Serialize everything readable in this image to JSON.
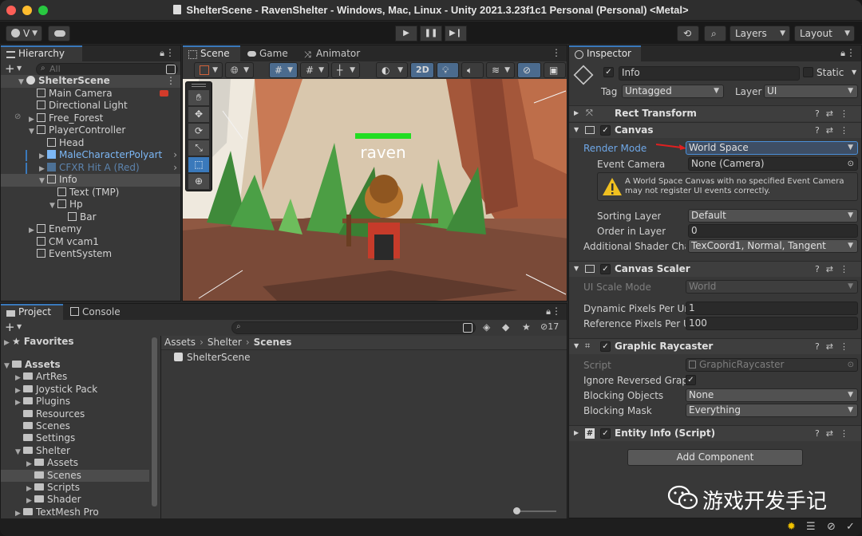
{
  "window": {
    "title": "ShelterScene - RavenShelter - Windows, Mac, Linux - Unity 2021.3.23f1c1 Personal (Personal) <Metal>"
  },
  "toolbar": {
    "account_label": "V",
    "layers_label": "Layers",
    "layout_label": "Layout",
    "play_icon": "play-icon",
    "pause_icon": "pause-icon",
    "step_icon": "step-icon"
  },
  "hierarchy": {
    "tab_label": "Hierarchy",
    "search_placeholder": "All",
    "items": [
      {
        "label": "ShelterScene",
        "depth": 0,
        "expanded": true,
        "kind": "scene"
      },
      {
        "label": "Main Camera",
        "depth": 1,
        "kind": "object"
      },
      {
        "label": "Directional Light",
        "depth": 1,
        "kind": "object"
      },
      {
        "label": "Free_Forest",
        "depth": 1,
        "expanded": false,
        "kind": "object"
      },
      {
        "label": "PlayerController",
        "depth": 1,
        "expanded": true,
        "kind": "object"
      },
      {
        "label": "Head",
        "depth": 2,
        "kind": "object"
      },
      {
        "label": "MaleCharacterPolyart",
        "depth": 2,
        "expanded": false,
        "kind": "prefab"
      },
      {
        "label": "CFXR Hit A (Red)",
        "depth": 2,
        "expanded": false,
        "kind": "prefab-dim"
      },
      {
        "label": "Info",
        "depth": 2,
        "expanded": true,
        "kind": "object",
        "selected": true
      },
      {
        "label": "Text (TMP)",
        "depth": 3,
        "kind": "object"
      },
      {
        "label": "Hp",
        "depth": 3,
        "expanded": true,
        "kind": "object"
      },
      {
        "label": "Bar",
        "depth": 4,
        "kind": "object"
      },
      {
        "label": "Enemy",
        "depth": 1,
        "expanded": false,
        "kind": "object"
      },
      {
        "label": "CM vcam1",
        "depth": 1,
        "kind": "object"
      },
      {
        "label": "EventSystem",
        "depth": 1,
        "kind": "object"
      }
    ]
  },
  "scene_view": {
    "tabs": [
      "Scene",
      "Game",
      "Animator"
    ],
    "mode_2d_label": "2D",
    "character_name": "raven",
    "health_fraction": 1.0,
    "health_color": "#22dd22"
  },
  "project": {
    "tabs": [
      "Project",
      "Console"
    ],
    "hidden_count": "17",
    "favorites_label": "Favorites",
    "tree": [
      {
        "label": "Assets",
        "depth": 0,
        "expanded": true,
        "bold": true
      },
      {
        "label": "ArtRes",
        "depth": 1,
        "expanded": false
      },
      {
        "label": "Joystick Pack",
        "depth": 1,
        "expanded": false
      },
      {
        "label": "Plugins",
        "depth": 1,
        "expanded": false
      },
      {
        "label": "Resources",
        "depth": 1
      },
      {
        "label": "Scenes",
        "depth": 1
      },
      {
        "label": "Settings",
        "depth": 1
      },
      {
        "label": "Shelter",
        "depth": 1,
        "expanded": true
      },
      {
        "label": "Assets",
        "depth": 2,
        "expanded": false
      },
      {
        "label": "Scenes",
        "depth": 2,
        "selected": true
      },
      {
        "label": "Scripts",
        "depth": 2,
        "expanded": false
      },
      {
        "label": "Shader",
        "depth": 2,
        "expanded": false
      },
      {
        "label": "TextMesh Pro",
        "depth": 1,
        "expanded": false
      }
    ],
    "breadcrumb": [
      "Assets",
      "Shelter",
      "Scenes"
    ],
    "files": [
      "ShelterScene"
    ]
  },
  "inspector": {
    "tab_label": "Inspector",
    "object_name": "Info",
    "static_label": "Static",
    "tag_label": "Tag",
    "tag_value": "Untagged",
    "layer_label": "Layer",
    "layer_value": "UI",
    "components": {
      "rect_transform": "Rect Transform",
      "canvas": "Canvas",
      "canvas_scaler": "Canvas Scaler",
      "graphic_raycaster": "Graphic Raycaster",
      "entity_info": "Entity Info (Script)"
    },
    "canvas": {
      "render_mode_label": "Render Mode",
      "render_mode_value": "World Space",
      "event_camera_label": "Event Camera",
      "event_camera_value": "None (Camera)",
      "warning": "A World Space Canvas with no specified Event Camera may not register UI events correctly.",
      "sorting_layer_label": "Sorting Layer",
      "sorting_layer_value": "Default",
      "order_label": "Order in Layer",
      "order_value": "0",
      "shader_label": "Additional Shader Chan",
      "shader_value": "TexCoord1, Normal, Tangent"
    },
    "scaler": {
      "mode_label": "UI Scale Mode",
      "mode_value": "World",
      "dpu_label": "Dynamic Pixels Per Unit",
      "dpu_value": "1",
      "rppu_label": "Reference Pixels Per Ur",
      "rppu_value": "100"
    },
    "raycaster": {
      "script_label": "Script",
      "script_value": "GraphicRaycaster",
      "ignore_label": "Ignore Reversed Graphi",
      "blocking_objects_label": "Blocking Objects",
      "blocking_objects_value": "None",
      "blocking_mask_label": "Blocking Mask",
      "blocking_mask_value": "Everything"
    },
    "add_component_label": "Add Component"
  },
  "watermark": {
    "text": "游戏开发手记"
  },
  "colors": {
    "accent": "#3a79bb",
    "prefab_blue": "#7cb7f5",
    "warning_yellow": "#f0c020"
  }
}
